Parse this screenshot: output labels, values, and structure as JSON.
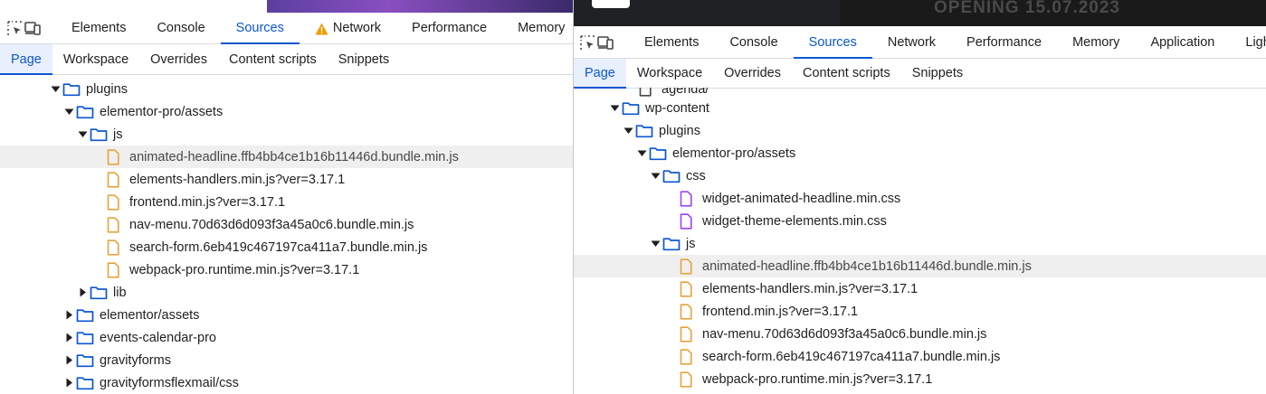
{
  "left_panel": {
    "toolbar_tabs": [
      {
        "label": "Elements",
        "active": false,
        "warning": false
      },
      {
        "label": "Console",
        "active": false,
        "warning": false
      },
      {
        "label": "Sources",
        "active": true,
        "warning": false
      },
      {
        "label": "Network",
        "active": false,
        "warning": true
      },
      {
        "label": "Performance",
        "active": false,
        "warning": false
      },
      {
        "label": "Memory",
        "active": false,
        "warning": false
      }
    ],
    "subtabs": [
      {
        "label": "Page",
        "active": true
      },
      {
        "label": "Workspace",
        "active": false
      },
      {
        "label": "Overrides",
        "active": false
      },
      {
        "label": "Content scripts",
        "active": false
      },
      {
        "label": "Snippets",
        "active": false
      }
    ],
    "tree": [
      {
        "label": "plugins",
        "type": "folder",
        "depth": 0,
        "expanded": true
      },
      {
        "label": "elementor-pro/assets",
        "type": "folder",
        "depth": 1,
        "expanded": true
      },
      {
        "label": "js",
        "type": "folder",
        "depth": 2,
        "expanded": true
      },
      {
        "label": "animated-headline.ffb4bb4ce1b16b11446d.bundle.min.js",
        "type": "js",
        "depth": 3,
        "selected": true
      },
      {
        "label": "elements-handlers.min.js?ver=3.17.1",
        "type": "js",
        "depth": 3
      },
      {
        "label": "frontend.min.js?ver=3.17.1",
        "type": "js",
        "depth": 3
      },
      {
        "label": "nav-menu.70d63d6d093f3a45a0c6.bundle.min.js",
        "type": "js",
        "depth": 3
      },
      {
        "label": "search-form.6eb419c467197ca411a7.bundle.min.js",
        "type": "js",
        "depth": 3
      },
      {
        "label": "webpack-pro.runtime.min.js?ver=3.17.1",
        "type": "js",
        "depth": 3
      },
      {
        "label": "lib",
        "type": "folder",
        "depth": 2,
        "expanded": false
      },
      {
        "label": "elementor/assets",
        "type": "folder",
        "depth": 1,
        "expanded": false
      },
      {
        "label": "events-calendar-pro",
        "type": "folder",
        "depth": 1,
        "expanded": false
      },
      {
        "label": "gravityforms",
        "type": "folder",
        "depth": 1,
        "expanded": false
      },
      {
        "label": "gravityformsflexmail/css",
        "type": "folder",
        "depth": 1,
        "expanded": false
      }
    ]
  },
  "right_panel": {
    "banner_text": "OPENING 15.07.2023",
    "toolbar_tabs": [
      {
        "label": "Elements",
        "active": false,
        "warning": false
      },
      {
        "label": "Console",
        "active": false,
        "warning": false
      },
      {
        "label": "Sources",
        "active": true,
        "warning": false
      },
      {
        "label": "Network",
        "active": false,
        "warning": false
      },
      {
        "label": "Performance",
        "active": false,
        "warning": false
      },
      {
        "label": "Memory",
        "active": false,
        "warning": false
      },
      {
        "label": "Application",
        "active": false,
        "warning": false
      },
      {
        "label": "Light",
        "active": false,
        "warning": false
      }
    ],
    "subtabs": [
      {
        "label": "Page",
        "active": true
      },
      {
        "label": "Workspace",
        "active": false
      },
      {
        "label": "Overrides",
        "active": false
      },
      {
        "label": "Content scripts",
        "active": false
      },
      {
        "label": "Snippets",
        "active": false
      }
    ],
    "tree": [
      {
        "label": "agenda/",
        "type": "file",
        "depth": 1,
        "partial": true
      },
      {
        "label": "wp-content",
        "type": "folder",
        "depth": 0,
        "expanded": true
      },
      {
        "label": "plugins",
        "type": "folder",
        "depth": 1,
        "expanded": true
      },
      {
        "label": "elementor-pro/assets",
        "type": "folder",
        "depth": 2,
        "expanded": true
      },
      {
        "label": "css",
        "type": "folder",
        "depth": 3,
        "expanded": true
      },
      {
        "label": "widget-animated-headline.min.css",
        "type": "css",
        "depth": 4
      },
      {
        "label": "widget-theme-elements.min.css",
        "type": "css",
        "depth": 4
      },
      {
        "label": "js",
        "type": "folder",
        "depth": 3,
        "expanded": true
      },
      {
        "label": "animated-headline.ffb4bb4ce1b16b11446d.bundle.min.js",
        "type": "js",
        "depth": 4,
        "selected": true
      },
      {
        "label": "elements-handlers.min.js?ver=3.17.1",
        "type": "js",
        "depth": 4
      },
      {
        "label": "frontend.min.js?ver=3.17.1",
        "type": "js",
        "depth": 4
      },
      {
        "label": "nav-menu.70d63d6d093f3a45a0c6.bundle.min.js",
        "type": "js",
        "depth": 4
      },
      {
        "label": "search-form.6eb419c467197ca411a7.bundle.min.js",
        "type": "js",
        "depth": 4
      },
      {
        "label": "webpack-pro.runtime.min.js?ver=3.17.1",
        "type": "js",
        "depth": 4
      }
    ]
  },
  "colors": {
    "accent": "#0b57d0",
    "folder": "#0b57d0",
    "js_file": "#e8a33d",
    "css_file": "#a142f4",
    "warning": "#f29900",
    "selected_row": "#efefef"
  }
}
